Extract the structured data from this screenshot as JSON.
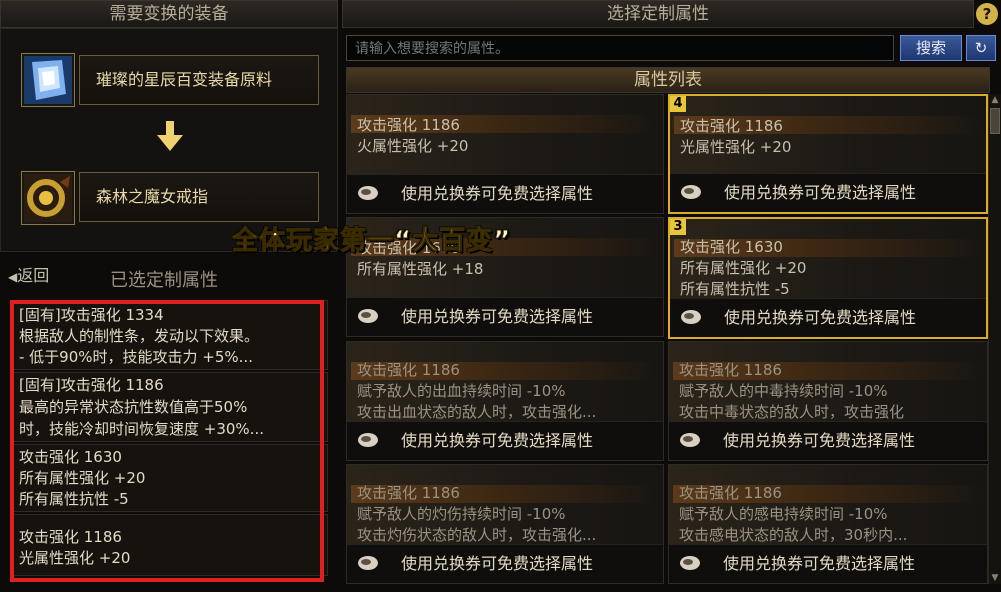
{
  "left": {
    "header": "需要变换的装备",
    "source_item": {
      "name": "璀璨的星辰百变装备原料",
      "icon": "crystal-material-icon"
    },
    "arrow": "down-arrow-icon",
    "target_item": {
      "name": "森林之魔女戒指",
      "icon": "ring-icon"
    },
    "back_label": "返回",
    "selected_header": "已选定制属性",
    "selected_rows": [
      {
        "lines": [
          "[固有]攻击强化 1334",
          "根据敌人的制性条，发动以下效果。",
          "- 低于90%时，技能攻击力 +5%..."
        ]
      },
      {
        "lines": [
          "[固有]攻击强化 1186",
          "最高的异常状态抗性数值高于50%",
          "时，技能冷却时间恢复速度 +30%..."
        ]
      },
      {
        "lines": [
          "攻击强化 1630",
          "所有属性强化 +20",
          "所有属性抗性 -5"
        ]
      },
      {
        "lines": [
          "攻击强化 1186",
          "光属性强化 +20"
        ]
      }
    ]
  },
  "right": {
    "header": "选择定制属性",
    "help_label": "?",
    "search": {
      "placeholder": "请输入想要搜索的属性。",
      "button": "搜索",
      "refresh_icon": "refresh-icon"
    },
    "list_header": "属性列表",
    "footer_text": "使用兑换券可免费选择属性",
    "cards": [
      {
        "badge": "",
        "lines": [
          "攻击强化 1186",
          "火属性强化 +20"
        ]
      },
      {
        "badge": "4",
        "lines": [
          "攻击强化 1186",
          "光属性强化 +20"
        ]
      },
      {
        "badge": "",
        "lines": [
          "攻击强化 1630",
          "所有属性强化 +18"
        ]
      },
      {
        "badge": "3",
        "lines": [
          "攻击强化 1630",
          "所有属性强化 +20",
          "所有属性抗性 -5"
        ]
      },
      {
        "badge": "",
        "lines": [
          "攻击强化 1186",
          "赋予敌人的出血持续时间 -10%",
          "攻击出血状态的敌人时，攻击强化..."
        ]
      },
      {
        "badge": "",
        "lines": [
          "攻击强化 1186",
          "赋予敌人的中毒持续时间 -10%",
          "攻击中毒状态的敌人时，攻击强化"
        ]
      },
      {
        "badge": "",
        "lines": [
          "攻击强化 1186",
          "赋予敌人的灼伤持续时间 -10%",
          "攻击灼伤状态的敌人时，攻击强化..."
        ]
      },
      {
        "badge": "",
        "lines": [
          "攻击强化 1186",
          "赋予敌人的感电持续时间 -10%",
          "攻击感电状态的敌人时，30秒内..."
        ]
      }
    ]
  },
  "overlay_caption": "全体玩家第一“大百变”",
  "colors": {
    "gold_border": "#d9ad2a",
    "highlight_red": "#e02020",
    "search_blue": "#2e4c8c"
  }
}
